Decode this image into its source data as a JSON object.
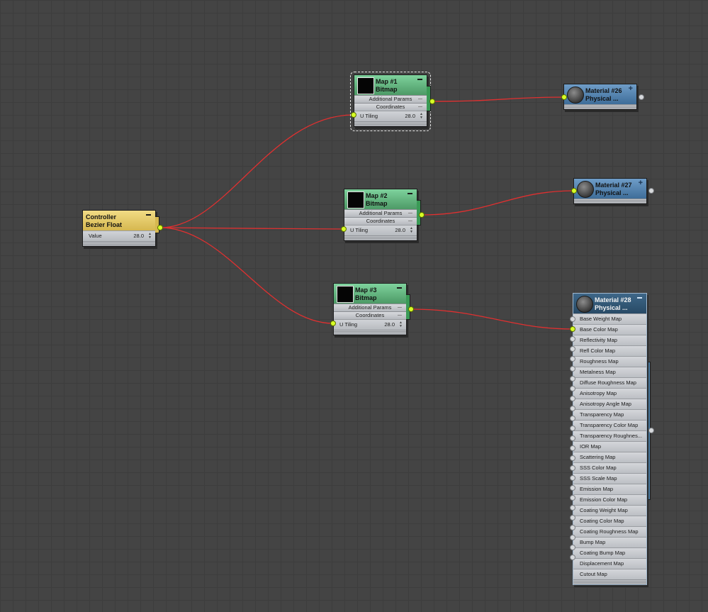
{
  "controller": {
    "title": "Controller",
    "subtitle": "Bezier Float",
    "param_label": "Value",
    "param_value": "28.0"
  },
  "maps": [
    {
      "title": "Map #1",
      "subtitle": "Bitmap",
      "sections": [
        "Additional Params",
        "Coordinates"
      ],
      "param_label": "U Tiling",
      "param_value": "28.0"
    },
    {
      "title": "Map #2",
      "subtitle": "Bitmap",
      "sections": [
        "Additional Params",
        "Coordinates"
      ],
      "param_label": "U Tiling",
      "param_value": "28.0"
    },
    {
      "title": "Map #3",
      "subtitle": "Bitmap",
      "sections": [
        "Additional Params",
        "Coordinates"
      ],
      "param_label": "U Tiling",
      "param_value": "28.0"
    }
  ],
  "materials": [
    {
      "title": "Material #26",
      "subtitle": "Physical ..."
    },
    {
      "title": "Material #27",
      "subtitle": "Physical ..."
    },
    {
      "title": "Material #28",
      "subtitle": "Physical ..."
    }
  ],
  "material28_slots": [
    "Base Weight Map",
    "Base Color Map",
    "Reflectivity Map",
    "Refl Color Map",
    "Roughness Map",
    "Metalness Map",
    "Diffuse Roughness Map",
    "Anisotropy Map",
    "Anisotropy Angle Map",
    "Transparency Map",
    "Transparency Color Map",
    "Transparency Roughnes...",
    "IOR Map",
    "Scattering Map",
    "SSS Color Map",
    "SSS Scale Map",
    "Emission Map",
    "Emission Color Map",
    "Coating Weight Map",
    "Coating Color Map",
    "Coating Roughness Map",
    "Bump Map",
    "Coating Bump Map",
    "Displacement Map",
    "Cutout Map"
  ],
  "icons": {
    "collapse": "minus-icon",
    "expand": "plus-icon",
    "spinner": "spinner-arrows-icon"
  },
  "colors": {
    "canvas": "#444444",
    "wire": "#e03030",
    "socket_active": "#d7ff26",
    "controller_header": "#e6c964",
    "map_header": "#62b47e",
    "material_header": "#5683ad",
    "material_selected_header": "#335a7a"
  }
}
